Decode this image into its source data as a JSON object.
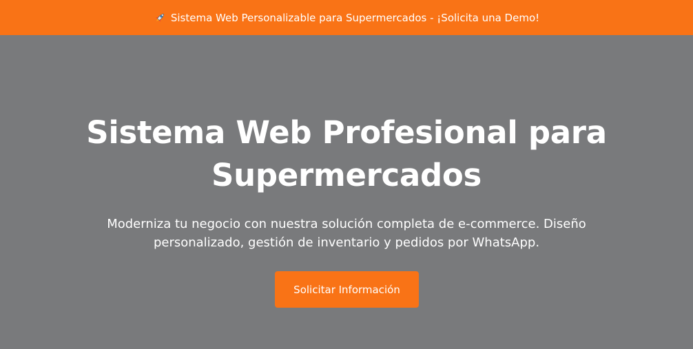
{
  "banner": {
    "icon": "rocket-icon",
    "text": "Sistema Web Personalizable para Supermercados - ¡Solicita una Demo!",
    "background": "#f97316"
  },
  "hero": {
    "title": "Sistema Web Profesional para Supermercados",
    "subtitle": "Moderniza tu negocio con nuestra solución completa de e-commerce. Diseño personalizado, gestión de inventario y pedidos por WhatsApp.",
    "cta_label": "Solicitar Información",
    "background": "#797a7c",
    "accent": "#f97316"
  }
}
